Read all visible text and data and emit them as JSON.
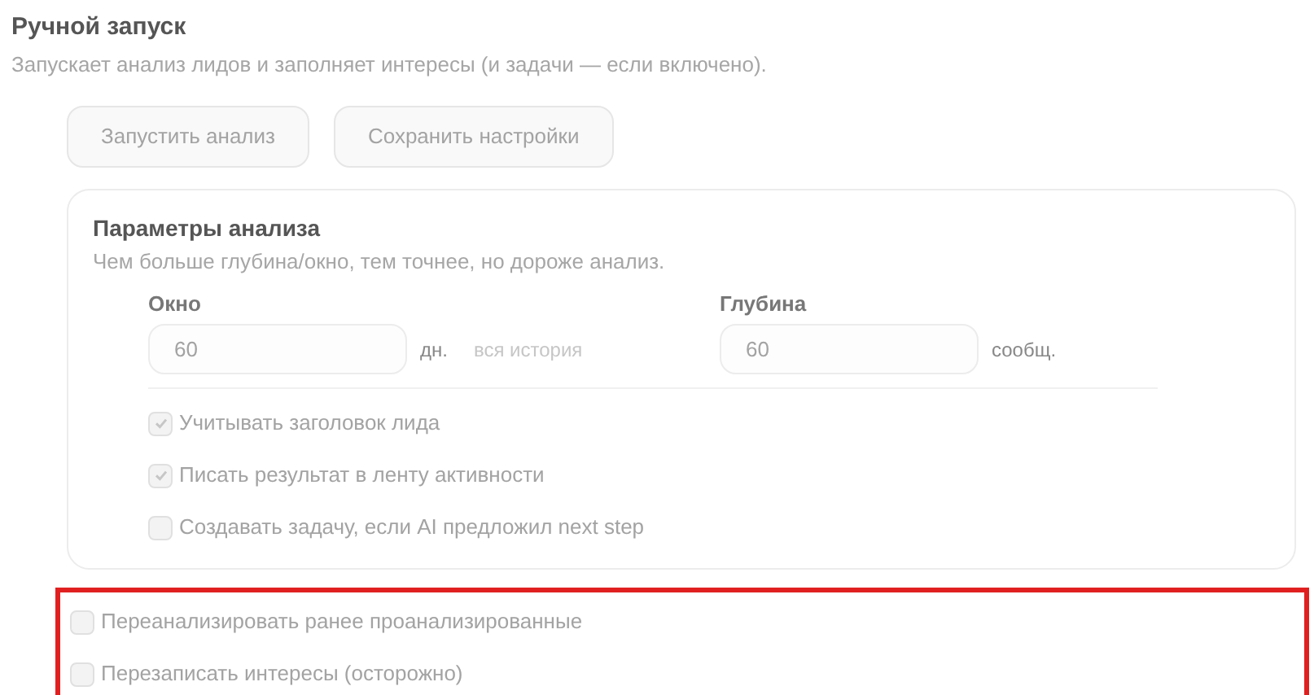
{
  "section": {
    "title": "Ручной запуск",
    "description": "Запускает анализ лидов и заполняет интересы (и задачи — если включено)."
  },
  "buttons": [
    {
      "label": "Запустить анализ",
      "disabled": true
    },
    {
      "label": "Сохранить настройки",
      "disabled": true
    }
  ],
  "params": {
    "title": "Параметры анализа",
    "description": "Чем больше глубина/окно, тем точнее, но дороже анализ.",
    "fields": [
      {
        "label": "Окно",
        "placeholder": "60",
        "unit": "дн.",
        "hint": "вся история",
        "disabled": true
      },
      {
        "label": "Глубина",
        "placeholder": "60",
        "unit": "сообщ.",
        "disabled": true
      }
    ],
    "options": [
      {
        "label": "Учитывать заголовок лида",
        "checked": true,
        "disabled": true
      },
      {
        "label": "Писать результат в ленту активности",
        "checked": true,
        "disabled": true
      },
      {
        "label": "Создавать задачу, если AI предложил next step",
        "checked": false,
        "disabled": true
      }
    ]
  },
  "extra_options": {
    "highlighted": true,
    "items": [
      {
        "label": "Переанализировать ранее проанализированные",
        "checked": false,
        "disabled": true
      },
      {
        "label": "Перезаписать интересы (осторожно)",
        "checked": false,
        "disabled": true
      }
    ]
  }
}
